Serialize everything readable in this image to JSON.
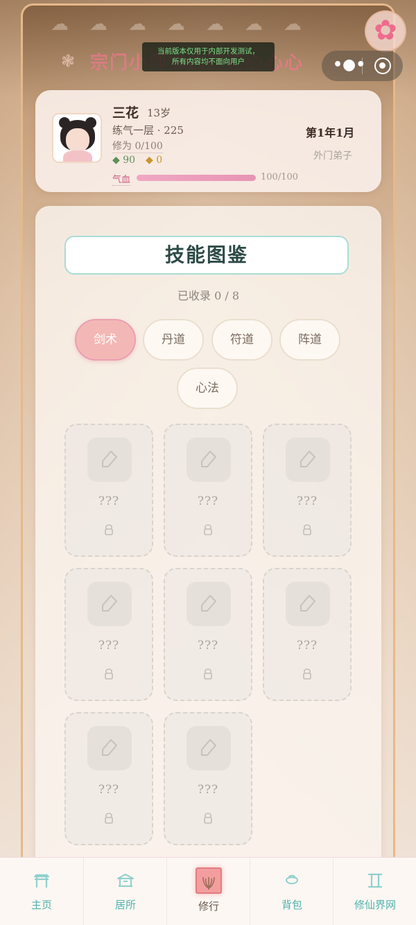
{
  "header": {
    "sect_title": "宗门小师妹的开花心心心",
    "toast_lines": [
      "当前版本仅用于内部开发测试，",
      "所有内容均不面向用户"
    ]
  },
  "profile": {
    "name": "三花",
    "age": "13岁",
    "realm": "练气一层 · 225",
    "cultivation": "修为 0/100",
    "spirit_stones": "90",
    "gold": "0",
    "hp_label": "气血",
    "hp_text": "100/100",
    "hp_fraction": 1.0,
    "date": "第1年1月",
    "rank": "外门弟子"
  },
  "panel": {
    "title": "技能图鉴",
    "collected": "已收录 0 / 8",
    "tabs": [
      {
        "label": "剑术",
        "active": true
      },
      {
        "label": "丹道",
        "active": false
      },
      {
        "label": "符道",
        "active": false
      },
      {
        "label": "阵道",
        "active": false
      },
      {
        "label": "心法",
        "active": false
      }
    ],
    "cards": [
      {
        "name": "???"
      },
      {
        "name": "???"
      },
      {
        "name": "???"
      },
      {
        "name": "???"
      },
      {
        "name": "???"
      },
      {
        "name": "???"
      },
      {
        "name": "???"
      },
      {
        "name": "???"
      }
    ]
  },
  "nav": {
    "items": [
      {
        "label": "主页",
        "icon": "gate-icon"
      },
      {
        "label": "居所",
        "icon": "house-icon"
      },
      {
        "label": "修行",
        "icon": "lotus-icon",
        "active": true
      },
      {
        "label": "背包",
        "icon": "bag-icon"
      },
      {
        "label": "修仙界网",
        "icon": "scroll-icon"
      }
    ]
  },
  "colors": {
    "accent_pink": "#f3b8b6",
    "accent_teal": "#4fb3ae",
    "title_border": "#a9ddd6"
  }
}
